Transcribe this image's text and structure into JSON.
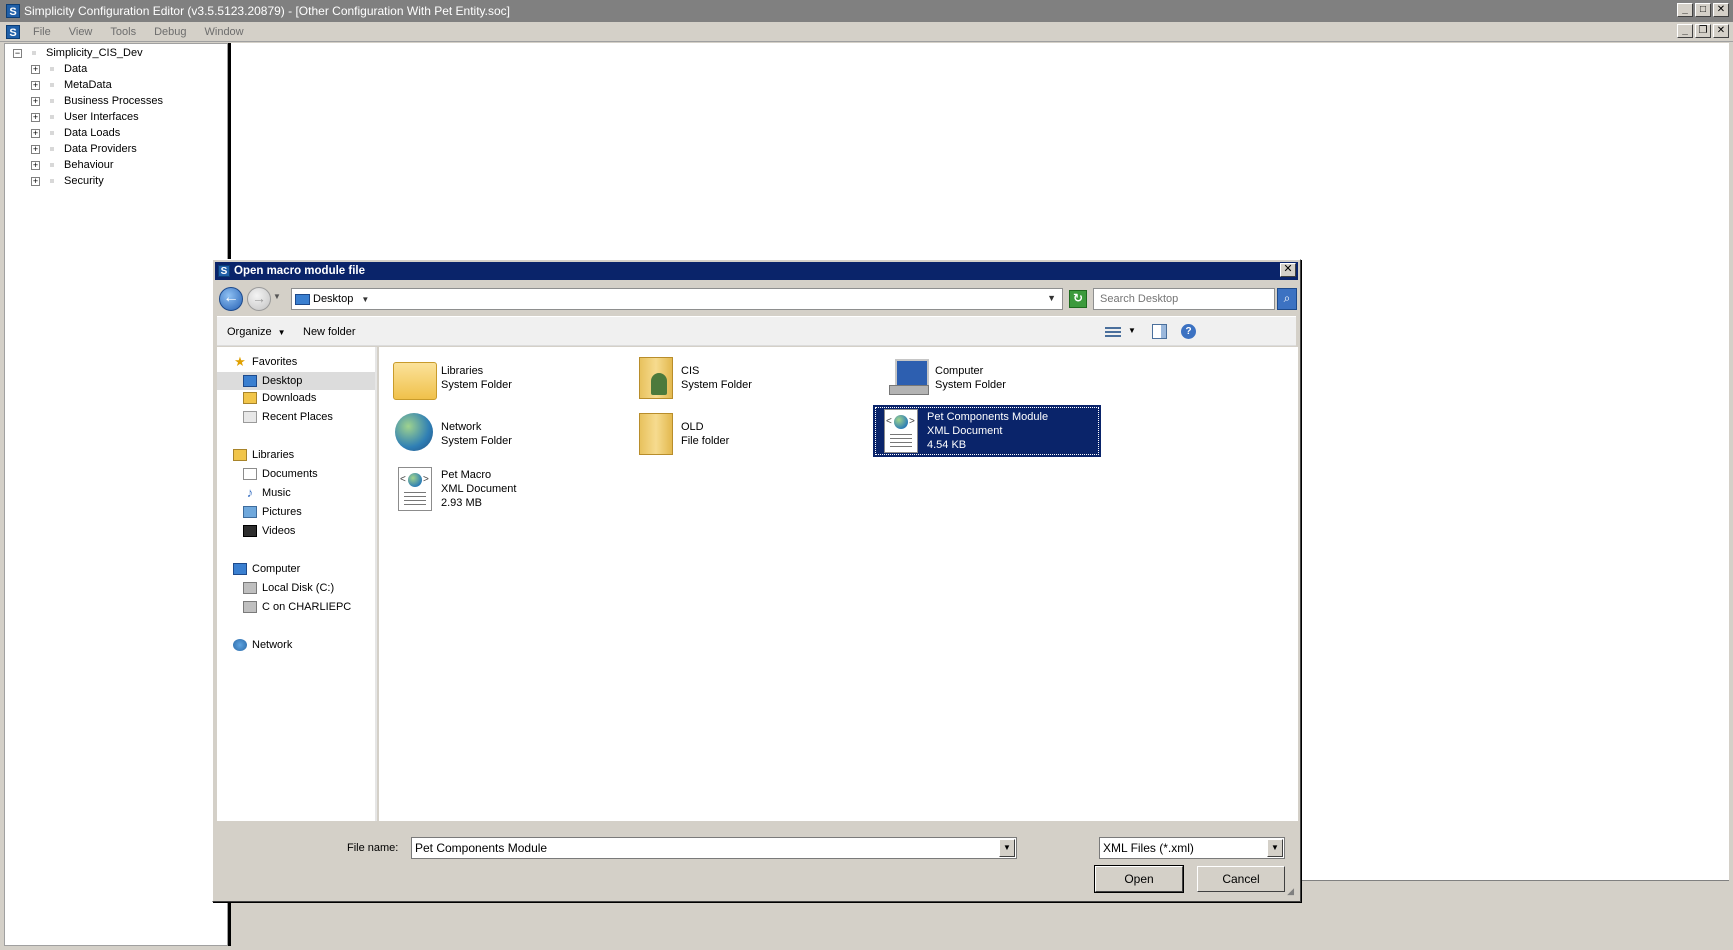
{
  "app": {
    "title": "Simplicity Configuration Editor (v3.5.5123.20879) - [Other Configuration With Pet Entity.soc]",
    "logo_letter": "S",
    "menu": [
      "File",
      "View",
      "Tools",
      "Debug",
      "Window"
    ]
  },
  "tree": {
    "root": "Simplicity_CIS_Dev",
    "items": [
      "Data",
      "MetaData",
      "Business Processes",
      "User Interfaces",
      "Data Loads",
      "Data Providers",
      "Behaviour",
      "Security"
    ]
  },
  "dialog": {
    "title": "Open macro module file",
    "address": "Desktop",
    "search_placeholder": "Search Desktop",
    "toolbar": {
      "organize": "Organize",
      "new_folder": "New folder"
    },
    "nav": {
      "favorites": "Favorites",
      "favorites_items": [
        "Desktop",
        "Downloads",
        "Recent Places"
      ],
      "libraries": "Libraries",
      "libraries_items": [
        "Documents",
        "Music",
        "Pictures",
        "Videos"
      ],
      "computer": "Computer",
      "computer_items": [
        "Local Disk (C:)",
        "C on CHARLIEPC"
      ],
      "network": "Network"
    },
    "files": [
      {
        "name": "Libraries",
        "type": "System Folder",
        "size": ""
      },
      {
        "name": "CIS",
        "type": "System Folder",
        "size": ""
      },
      {
        "name": "Computer",
        "type": "System Folder",
        "size": ""
      },
      {
        "name": "Network",
        "type": "System Folder",
        "size": ""
      },
      {
        "name": "OLD",
        "type": "File folder",
        "size": ""
      },
      {
        "name": "Pet Components Module",
        "type": "XML Document",
        "size": "4.54 KB"
      },
      {
        "name": "Pet Macro",
        "type": "XML Document",
        "size": "2.93 MB"
      }
    ],
    "file_name_label": "File name:",
    "file_name_value": "Pet Components Module",
    "file_type": "XML Files (*.xml)",
    "open_label": "Open",
    "cancel_label": "Cancel"
  }
}
